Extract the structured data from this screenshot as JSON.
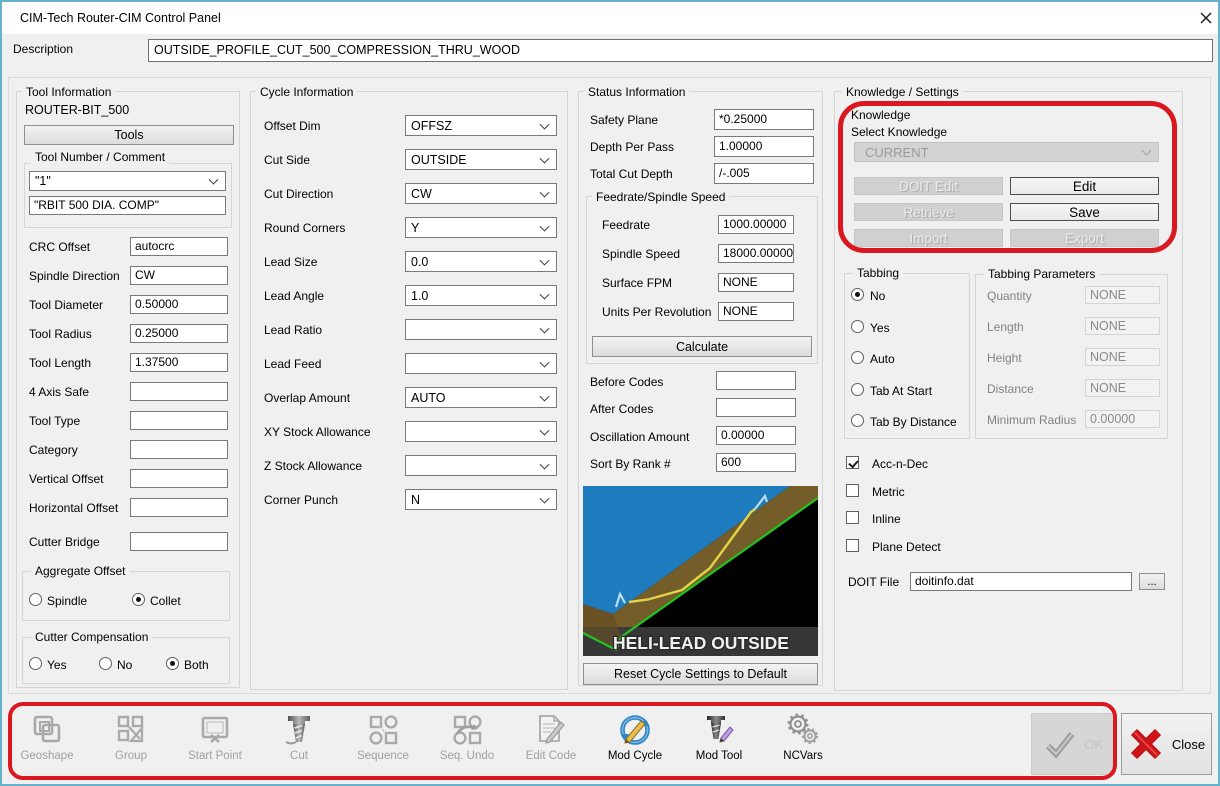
{
  "window": {
    "title": "CIM-Tech Router-CIM Control Panel"
  },
  "description": {
    "label": "Description",
    "value": "OUTSIDE_PROFILE_CUT_500_COMPRESSION_THRU_WOOD"
  },
  "tool_info": {
    "title": "Tool Information",
    "tool_name": "ROUTER-BIT_500",
    "tools_button": "Tools",
    "tool_number_group": {
      "title": "Tool Number / Comment",
      "number_value": "\"1\"",
      "comment_value": "\"RBIT 500 DIA. COMP\""
    },
    "fields": [
      {
        "label": "CRC Offset",
        "value": "autocrc"
      },
      {
        "label": "Spindle Direction",
        "value": "CW"
      },
      {
        "label": "Tool Diameter",
        "value": "0.50000"
      },
      {
        "label": "Tool Radius",
        "value": "0.25000"
      },
      {
        "label": "Tool Length",
        "value": "1.37500"
      },
      {
        "label": "4 Axis Safe",
        "value": ""
      },
      {
        "label": "Tool Type",
        "value": ""
      },
      {
        "label": "Category",
        "value": ""
      },
      {
        "label": "Vertical Offset",
        "value": ""
      },
      {
        "label": "Horizontal Offset",
        "value": ""
      },
      {
        "label": "Cutter Bridge",
        "value": ""
      }
    ],
    "aggregate_offset": {
      "title": "Aggregate Offset",
      "options": [
        {
          "label": "Spindle",
          "selected": false
        },
        {
          "label": "Collet",
          "selected": true
        }
      ]
    },
    "cutter_compensation": {
      "title": "Cutter Compensation",
      "options": [
        {
          "label": "Yes",
          "selected": false
        },
        {
          "label": "No",
          "selected": false
        },
        {
          "label": "Both",
          "selected": true
        }
      ]
    }
  },
  "cycle_info": {
    "title": "Cycle Information",
    "fields": [
      {
        "label": "Offset Dim",
        "value": "OFFSZ"
      },
      {
        "label": "Cut Side",
        "value": "OUTSIDE"
      },
      {
        "label": "Cut Direction",
        "value": "CW"
      },
      {
        "label": "Round Corners",
        "value": "Y"
      },
      {
        "label": "Lead Size",
        "value": "0.0"
      },
      {
        "label": "Lead Angle",
        "value": "1.0"
      },
      {
        "label": "Lead Ratio",
        "value": ""
      },
      {
        "label": "Lead Feed",
        "value": ""
      },
      {
        "label": "Overlap Amount",
        "value": "AUTO"
      },
      {
        "label": "XY Stock Allowance",
        "value": ""
      },
      {
        "label": "Z Stock Allowance",
        "value": ""
      },
      {
        "label": "Corner Punch",
        "value": "N"
      }
    ]
  },
  "status_info": {
    "title": "Status Information",
    "fields_top": [
      {
        "label": "Safety Plane",
        "value": "*0.25000"
      },
      {
        "label": "Depth Per Pass",
        "value": "1.00000"
      },
      {
        "label": "Total Cut Depth",
        "value": "/-.005"
      }
    ],
    "feedrate_group": {
      "title": "Feedrate/Spindle Speed",
      "fields": [
        {
          "label": "Feedrate",
          "value": "1000.00000"
        },
        {
          "label": "Spindle Speed",
          "value": "18000.00000"
        },
        {
          "label": "Surface FPM",
          "value": "NONE"
        },
        {
          "label": "Units Per Revolution",
          "value": "NONE"
        }
      ],
      "calculate_button": "Calculate"
    },
    "fields_bottom": [
      {
        "label": "Before Codes",
        "value": ""
      },
      {
        "label": "After Codes",
        "value": ""
      },
      {
        "label": "Oscillation Amount",
        "value": "0.00000"
      },
      {
        "label": "Sort By Rank #",
        "value": "600"
      }
    ],
    "preview_caption": "HELI-LEAD OUTSIDE",
    "reset_button": "Reset Cycle Settings to Default"
  },
  "knowledge_settings": {
    "title": "Knowledge / Settings",
    "knowledge": {
      "title": "Knowledge",
      "select_label": "Select Knowledge",
      "select_value": "CURRENT",
      "buttons": [
        {
          "label": "DOIT Edit",
          "enabled": false
        },
        {
          "label": "Edit",
          "enabled": true
        },
        {
          "label": "Retrieve",
          "enabled": false
        },
        {
          "label": "Save",
          "enabled": true
        },
        {
          "label": "Import",
          "enabled": false
        },
        {
          "label": "Export",
          "enabled": false
        }
      ]
    },
    "tabbing": {
      "title": "Tabbing",
      "options": [
        {
          "label": "No",
          "selected": true
        },
        {
          "label": "Yes",
          "selected": false
        },
        {
          "label": "Auto",
          "selected": false
        },
        {
          "label": "Tab At Start",
          "selected": false
        },
        {
          "label": "Tab By Distance",
          "selected": false
        }
      ]
    },
    "tabbing_parameters": {
      "title": "Tabbing Parameters",
      "fields": [
        {
          "label": "Quantity",
          "value": "NONE"
        },
        {
          "label": "Length",
          "value": "NONE"
        },
        {
          "label": "Height",
          "value": "NONE"
        },
        {
          "label": "Distance",
          "value": "NONE"
        },
        {
          "label": "Minimum Radius",
          "value": "0.00000"
        }
      ]
    },
    "checkboxes": [
      {
        "label": "Acc-n-Dec",
        "checked": true
      },
      {
        "label": "Metric",
        "checked": false
      },
      {
        "label": "Inline",
        "checked": false
      },
      {
        "label": "Plane Detect",
        "checked": false
      }
    ],
    "doit_file": {
      "label": "DOIT File",
      "value": "doitinfo.dat",
      "browse_button": "..."
    }
  },
  "toolbar": {
    "buttons": [
      {
        "label": "Geoshape",
        "enabled": false
      },
      {
        "label": "Group",
        "enabled": false
      },
      {
        "label": "Start Point",
        "enabled": false
      },
      {
        "label": "Cut",
        "enabled": false
      },
      {
        "label": "Sequence",
        "enabled": false
      },
      {
        "label": "Seq. Undo",
        "enabled": false
      },
      {
        "label": "Edit Code",
        "enabled": false
      },
      {
        "label": "Mod Cycle",
        "enabled": true
      },
      {
        "label": "Mod Tool",
        "enabled": true
      },
      {
        "label": "NCVars",
        "enabled": true
      }
    ],
    "ok_button": "OK",
    "close_button": "Close"
  },
  "colors": {
    "window_border": "#63b4c9",
    "dialog_background": "#f0f0f0",
    "annotation_red": "#d9191f",
    "preview_blue": "#1e7bbd",
    "preview_brown": "#745d28",
    "preview_green": "#21c421",
    "preview_yellow": "#e3d348"
  }
}
